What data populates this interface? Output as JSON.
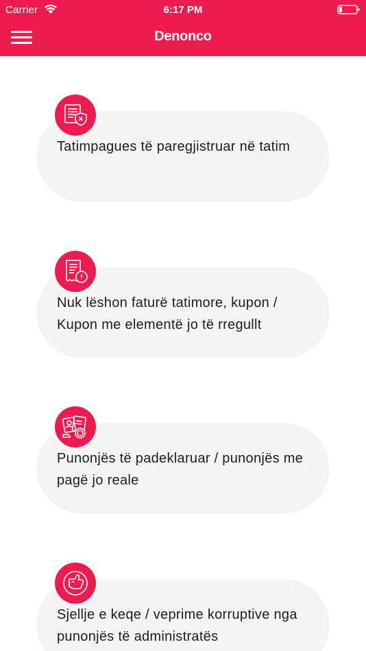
{
  "status_bar": {
    "carrier": "Carrier",
    "time": "6:17 PM"
  },
  "nav": {
    "title": "Denonco",
    "menu_icon": "hamburger-menu-icon"
  },
  "colors": {
    "brand": "#ee1b51",
    "card_background": "#f5f5f5",
    "text": "#1c1c1c"
  },
  "categories": [
    {
      "label": "Tatimpagues të paregjistruar në tatim",
      "icon": "unregistered-document-shield-icon"
    },
    {
      "label": "Nuk lëshon faturë tatimore, kupon / Kupon me elementë jo të rregullt",
      "icon": "receipt-warning-icon"
    },
    {
      "label": "Punonjës të padeklaruar / punonjës me pagë jo reale",
      "icon": "worker-documents-coin-icon"
    },
    {
      "label": "Sjellje e keqe / veprime korruptive nga punonjës të administratës",
      "icon": "thumbs-down-icon"
    }
  ]
}
